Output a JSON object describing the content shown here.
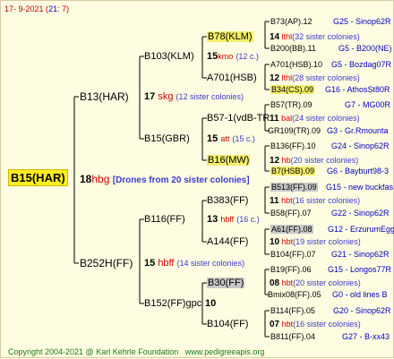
{
  "header": {
    "id": "17-",
    "date": "9-2021 (",
    "day": "21",
    "time": ": 7)"
  },
  "footer": {
    "copyright": "Copyright 2004-2021 @ Karl Kehrle Foundation",
    "site": "www.pedigreeapis.org"
  },
  "queen": {
    "name": "B15(HAR)",
    "num": "18",
    "abbr": "hbg",
    "note": "[Drones from 20 sister colonies]"
  },
  "mother": {
    "name": "B13(HAR)",
    "num": "17",
    "abbr": "skg",
    "note": "(12 sister colonies)"
  },
  "father": {
    "name": "B252H(FF)",
    "num": "15",
    "abbr": "hbff",
    "note": "(14 sister colonies)"
  },
  "gen3": {
    "mm": {
      "name": "B103(KLM)",
      "num": "15",
      "abbr": "kmo",
      "note": "(12 c.)"
    },
    "mf": {
      "name": "B15(GBR)",
      "num": "15",
      "abbr": "att",
      "note": "(15 c.)"
    },
    "fm": {
      "name": "B116(FF)",
      "num": "13",
      "abbr": "hbff",
      "note": "(16 c.)"
    },
    "ff": {
      "name": "B152(FF)gpc",
      "num": "10",
      "abbr": "",
      "note": ""
    }
  },
  "gen4": [
    {
      "name": "B78(KLM)",
      "num": "14",
      "abbr": "lthl",
      "note": "(32 sister colonies)"
    },
    {
      "name": "A701(HSB)",
      "num": "12",
      "abbr": "lthl",
      "note": "(28 sister colonies)"
    },
    {
      "name": "B57-1(vdB-TR)",
      "num": "11",
      "abbr": "bal",
      "note": "(24 sister colonies)"
    },
    {
      "name": "B16(MW)",
      "num": "12",
      "abbr": "hb",
      "note": "(20 sister colonies)"
    },
    {
      "name": "B383(FF)",
      "num": "11",
      "abbr": "hbt",
      "note": "(16 sister colonies)"
    },
    {
      "name": "A144(FF)",
      "num": "10",
      "abbr": "hbt",
      "note": "(19 sister colonies)"
    },
    {
      "name": "B30(FF)",
      "num": "08",
      "abbr": "hbt",
      "note": "(20 sister colonies)"
    },
    {
      "name": "B104(FF)",
      "num": "07",
      "abbr": "hbt",
      "note": "(16 sister colonies)"
    }
  ],
  "gen5": [
    {
      "name": "B73(AP).12",
      "info": "G25 - Sinop62R"
    },
    {
      "name": "B200(BB).11",
      "info": "G5 - B200(NE)"
    },
    {
      "name": "A701(HSB).10",
      "info": "G5 - Bozdag07R"
    },
    {
      "name": "B34(CS).09",
      "info": "G16 - AthosSt80R"
    },
    {
      "name": "B57(TR).09",
      "info": "G7 - MG00R"
    },
    {
      "name": "GR109(TR).09",
      "info": "G3 - Gr.Rmounta"
    },
    {
      "name": "B136(FF).10",
      "info": "G24 - Sinop62R"
    },
    {
      "name": "B7(HSB).09",
      "info": "G6 - Bayburt98-3"
    },
    {
      "name": "B513(FF).09",
      "info": "G15 - new buckfas"
    },
    {
      "name": "B58(FF).07",
      "info": "G22 - Sinop62R"
    },
    {
      "name": "A61(FF).08",
      "info": "G12 - ErzurumEgg8"
    },
    {
      "name": "B104(FF).07",
      "info": "G21 - Sinop62R"
    },
    {
      "name": "B19(FF).06",
      "info": "G15 - Longos77R"
    },
    {
      "name": "Bmix08(FF).05",
      "info": "G0 - old lines B"
    },
    {
      "name": "B114(FF).05",
      "info": "G20 - Sinop62R"
    },
    {
      "name": "B811(FF).04",
      "info": "G27 - B-xx43"
    }
  ]
}
